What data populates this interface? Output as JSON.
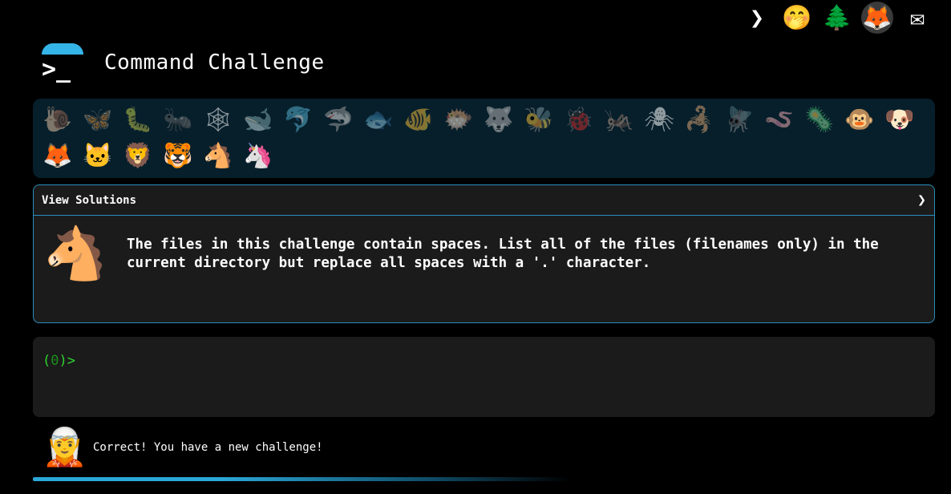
{
  "app": {
    "title": "Command Challenge"
  },
  "top_icons": [
    {
      "name": "command-logo-icon",
      "glyph": "❯"
    },
    {
      "name": "emoji-face-icon",
      "glyph": "🤭"
    },
    {
      "name": "tree-icon",
      "glyph": "🌲"
    },
    {
      "name": "gitlab-icon",
      "glyph": "🦊"
    },
    {
      "name": "mail-icon",
      "glyph": "✉"
    }
  ],
  "animals": [
    {
      "name": "snail-icon",
      "glyph": "🐌"
    },
    {
      "name": "butterfly-icon",
      "glyph": "🦋"
    },
    {
      "name": "caterpillar-icon",
      "glyph": "🐛"
    },
    {
      "name": "ant-icon",
      "glyph": "🐜"
    },
    {
      "name": "spider-web-icon",
      "glyph": "🕸"
    },
    {
      "name": "whale-icon",
      "glyph": "🐋"
    },
    {
      "name": "dolphin-icon",
      "glyph": "🐬"
    },
    {
      "name": "shark-icon",
      "glyph": "🦈"
    },
    {
      "name": "fish-icon",
      "glyph": "🐟"
    },
    {
      "name": "tropical-fish-icon",
      "glyph": "🐠"
    },
    {
      "name": "blowfish-icon",
      "glyph": "🐡"
    },
    {
      "name": "wolf-icon",
      "glyph": "🐺"
    },
    {
      "name": "bee-icon",
      "glyph": "🐝"
    },
    {
      "name": "ladybug-icon",
      "glyph": "🐞"
    },
    {
      "name": "cricket-icon",
      "glyph": "🦗"
    },
    {
      "name": "spider-icon",
      "glyph": "🕷"
    },
    {
      "name": "scorpion-icon",
      "glyph": "🦂"
    },
    {
      "name": "fly-icon",
      "glyph": "🪰"
    },
    {
      "name": "worm-icon",
      "glyph": "🪱"
    },
    {
      "name": "microbe-icon",
      "glyph": "🦠"
    },
    {
      "name": "monkey-icon",
      "glyph": "🐵"
    },
    {
      "name": "dog-icon",
      "glyph": "🐶"
    },
    {
      "name": "fox-icon",
      "glyph": "🦊"
    },
    {
      "name": "cat-icon",
      "glyph": "🐱"
    },
    {
      "name": "lion-icon",
      "glyph": "🦁"
    },
    {
      "name": "tiger-icon",
      "glyph": "🐯"
    },
    {
      "name": "horse-icon",
      "glyph": "🐴"
    },
    {
      "name": "unicorn-icon",
      "glyph": "🦄"
    }
  ],
  "solutions": {
    "label": "View Solutions",
    "chevron": "❯",
    "challenge_icon": "🐴",
    "description": "The files in this challenge contain spaces. List all of the files (filenames only) in the current directory but replace all spaces with a '.' character."
  },
  "terminal": {
    "prompt_open": "(",
    "prompt_count": "0",
    "prompt_close": ")>",
    "input_value": ""
  },
  "status": {
    "icon": "🧝",
    "message": "Correct! You have a new challenge!"
  },
  "colors": {
    "accent": "#2a8dbb",
    "prompt_green": "#2ed32e",
    "animals_bg": "#071f2b"
  }
}
